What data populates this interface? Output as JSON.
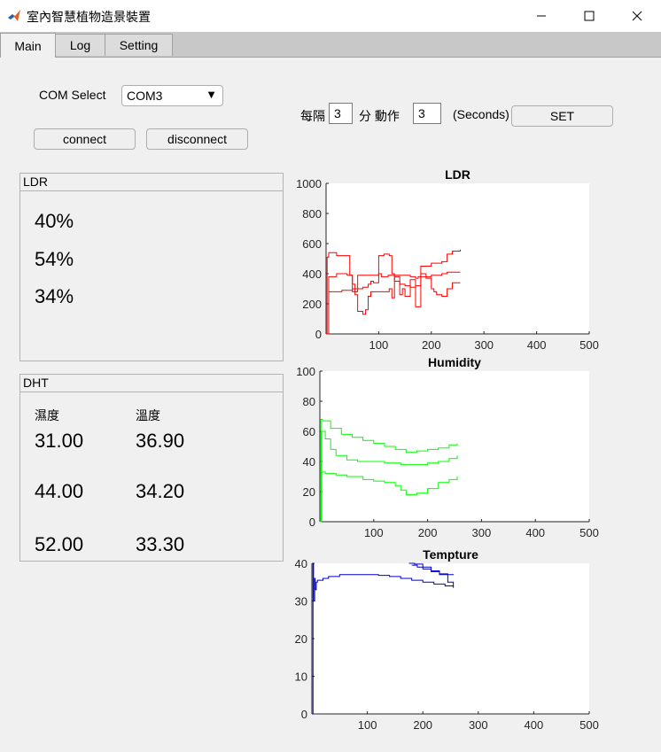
{
  "window": {
    "title": "室內智慧植物造景裝置",
    "icon": "matlab-icon",
    "controls": [
      "minimize-icon",
      "maximize-icon",
      "close-icon"
    ]
  },
  "tabs": [
    {
      "label": "Main",
      "active": true
    },
    {
      "label": "Log",
      "active": false
    },
    {
      "label": "Setting",
      "active": false
    }
  ],
  "com": {
    "label": "COM Select",
    "selected": "COM3",
    "connect_label": "connect",
    "disconnect_label": "disconnect"
  },
  "schedule": {
    "every_label": "每隔",
    "every_value": "3",
    "minute_label": "分 動作",
    "action_value": "3",
    "unit_label": "(Seconds)",
    "set_label": "SET"
  },
  "ldr_panel": {
    "title": "LDR",
    "values": [
      "40%",
      "54%",
      "34%"
    ]
  },
  "dht_panel": {
    "title": "DHT",
    "humidity_header": "濕度",
    "temperature_header": "溫度",
    "rows": [
      {
        "humidity": "31.00",
        "temperature": "36.90"
      },
      {
        "humidity": "44.00",
        "temperature": "34.20"
      },
      {
        "humidity": "52.00",
        "temperature": "33.30"
      }
    ]
  },
  "chart_data": [
    {
      "type": "line",
      "title": "LDR",
      "xlim": [
        0,
        500
      ],
      "ylim": [
        0,
        1000
      ],
      "xticks": [
        100,
        200,
        300,
        400,
        500
      ],
      "yticks": [
        0,
        200,
        400,
        600,
        800,
        1000
      ],
      "color": "#ff0000",
      "series": [
        {
          "x": [
            0,
            2,
            5,
            20,
            40,
            45,
            50,
            60,
            100,
            105,
            115,
            118,
            160,
            170,
            175,
            200,
            220,
            230,
            240,
            255
          ],
          "y": [
            0,
            510,
            540,
            520,
            520,
            390,
            280,
            390,
            400,
            380,
            380,
            390,
            380,
            370,
            380,
            390,
            400,
            410,
            410,
            410
          ]
        },
        {
          "x": [
            0,
            5,
            20,
            40,
            50,
            55,
            60,
            70,
            75,
            80,
            85,
            100,
            120,
            125,
            130,
            140,
            145,
            150,
            160,
            170,
            180,
            190,
            200,
            205,
            210,
            220,
            230,
            240,
            255
          ],
          "y": [
            0,
            380,
            400,
            390,
            330,
            260,
            150,
            130,
            160,
            250,
            280,
            280,
            300,
            240,
            380,
            260,
            300,
            250,
            360,
            180,
            400,
            370,
            300,
            280,
            260,
            250,
            300,
            340,
            340
          ]
        },
        {
          "x": [
            0,
            5,
            30,
            50,
            70,
            80,
            85,
            90,
            100,
            110,
            120,
            125,
            130,
            140,
            150,
            160,
            170,
            180,
            200,
            220,
            230,
            240,
            255
          ],
          "y": [
            0,
            280,
            290,
            300,
            310,
            330,
            350,
            340,
            520,
            530,
            520,
            400,
            350,
            330,
            320,
            310,
            320,
            450,
            470,
            480,
            530,
            550,
            560
          ]
        }
      ]
    },
    {
      "type": "line",
      "title": "Humidity",
      "xlim": [
        0,
        500
      ],
      "ylim": [
        0,
        100
      ],
      "xticks": [
        100,
        200,
        300,
        400,
        500
      ],
      "yticks": [
        0,
        20,
        40,
        60,
        80,
        100
      ],
      "color": "#00ff00",
      "series": [
        {
          "x": [
            0,
            2,
            5,
            20,
            40,
            60,
            80,
            100,
            120,
            140,
            160,
            180,
            200,
            220,
            240,
            255
          ],
          "y": [
            0,
            68,
            67,
            62,
            58,
            56,
            54,
            52,
            50,
            48,
            46,
            47,
            48,
            49,
            51,
            52
          ]
        },
        {
          "x": [
            0,
            3,
            10,
            20,
            30,
            50,
            70,
            100,
            120,
            150,
            180,
            200,
            220,
            240,
            255
          ],
          "y": [
            0,
            60,
            55,
            48,
            44,
            41,
            40,
            40,
            39,
            38,
            38,
            39,
            40,
            42,
            44
          ]
        },
        {
          "x": [
            0,
            3,
            10,
            30,
            50,
            80,
            100,
            120,
            140,
            150,
            160,
            180,
            200,
            220,
            240,
            255
          ],
          "y": [
            0,
            33,
            32,
            31,
            30,
            28,
            27,
            26,
            24,
            21,
            18,
            19,
            22,
            26,
            28,
            30
          ]
        }
      ]
    },
    {
      "type": "line",
      "title": "Tempture",
      "xlim": [
        0,
        500
      ],
      "ylim": [
        0,
        40
      ],
      "xticks": [
        100,
        200,
        300,
        400,
        500
      ],
      "yticks": [
        0,
        10,
        20,
        30,
        40
      ],
      "color": "#0000c8",
      "series": [
        {
          "x": [
            0,
            2,
            3,
            5,
            6,
            8,
            10,
            20,
            30,
            50,
            80,
            100,
            120,
            140,
            160,
            180,
            200,
            220,
            240,
            255
          ],
          "y": [
            0,
            40,
            30,
            36,
            33,
            35,
            35.5,
            36,
            36.5,
            37,
            37,
            37,
            36.8,
            36.5,
            36,
            35.5,
            35,
            34.5,
            34,
            33.5
          ]
        },
        {
          "x": [
            175,
            185,
            200,
            215,
            230,
            245,
            255
          ],
          "y": [
            40,
            39.8,
            39,
            38,
            37,
            35,
            34
          ]
        },
        {
          "x": [
            180,
            190,
            200,
            215,
            230,
            245,
            255
          ],
          "y": [
            39.5,
            39,
            38.5,
            37.8,
            37.2,
            37,
            36.9
          ]
        }
      ]
    }
  ]
}
